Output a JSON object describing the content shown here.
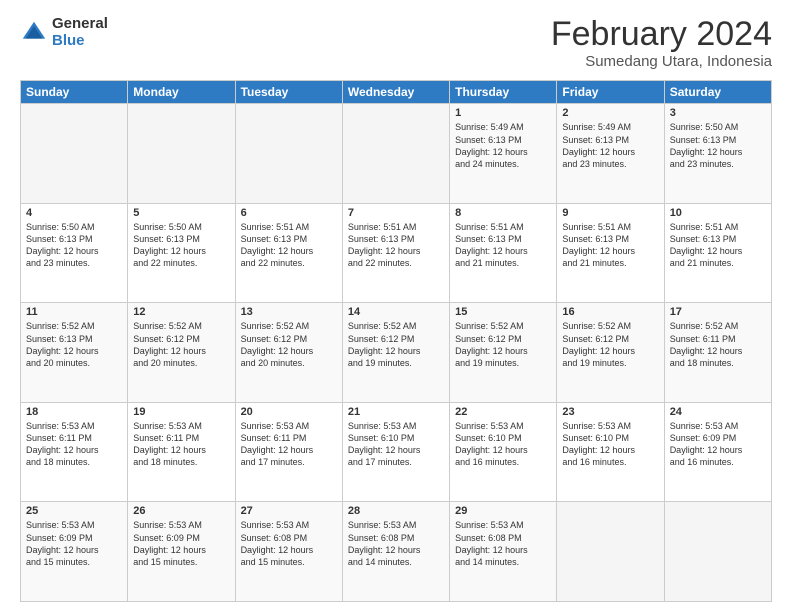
{
  "logo": {
    "general": "General",
    "blue": "Blue"
  },
  "header": {
    "month": "February 2024",
    "location": "Sumedang Utara, Indonesia"
  },
  "weekdays": [
    "Sunday",
    "Monday",
    "Tuesday",
    "Wednesday",
    "Thursday",
    "Friday",
    "Saturday"
  ],
  "weeks": [
    [
      {
        "day": "",
        "info": ""
      },
      {
        "day": "",
        "info": ""
      },
      {
        "day": "",
        "info": ""
      },
      {
        "day": "",
        "info": ""
      },
      {
        "day": "1",
        "info": "Sunrise: 5:49 AM\nSunset: 6:13 PM\nDaylight: 12 hours\nand 24 minutes."
      },
      {
        "day": "2",
        "info": "Sunrise: 5:49 AM\nSunset: 6:13 PM\nDaylight: 12 hours\nand 23 minutes."
      },
      {
        "day": "3",
        "info": "Sunrise: 5:50 AM\nSunset: 6:13 PM\nDaylight: 12 hours\nand 23 minutes."
      }
    ],
    [
      {
        "day": "4",
        "info": "Sunrise: 5:50 AM\nSunset: 6:13 PM\nDaylight: 12 hours\nand 23 minutes."
      },
      {
        "day": "5",
        "info": "Sunrise: 5:50 AM\nSunset: 6:13 PM\nDaylight: 12 hours\nand 22 minutes."
      },
      {
        "day": "6",
        "info": "Sunrise: 5:51 AM\nSunset: 6:13 PM\nDaylight: 12 hours\nand 22 minutes."
      },
      {
        "day": "7",
        "info": "Sunrise: 5:51 AM\nSunset: 6:13 PM\nDaylight: 12 hours\nand 22 minutes."
      },
      {
        "day": "8",
        "info": "Sunrise: 5:51 AM\nSunset: 6:13 PM\nDaylight: 12 hours\nand 21 minutes."
      },
      {
        "day": "9",
        "info": "Sunrise: 5:51 AM\nSunset: 6:13 PM\nDaylight: 12 hours\nand 21 minutes."
      },
      {
        "day": "10",
        "info": "Sunrise: 5:51 AM\nSunset: 6:13 PM\nDaylight: 12 hours\nand 21 minutes."
      }
    ],
    [
      {
        "day": "11",
        "info": "Sunrise: 5:52 AM\nSunset: 6:13 PM\nDaylight: 12 hours\nand 20 minutes."
      },
      {
        "day": "12",
        "info": "Sunrise: 5:52 AM\nSunset: 6:12 PM\nDaylight: 12 hours\nand 20 minutes."
      },
      {
        "day": "13",
        "info": "Sunrise: 5:52 AM\nSunset: 6:12 PM\nDaylight: 12 hours\nand 20 minutes."
      },
      {
        "day": "14",
        "info": "Sunrise: 5:52 AM\nSunset: 6:12 PM\nDaylight: 12 hours\nand 19 minutes."
      },
      {
        "day": "15",
        "info": "Sunrise: 5:52 AM\nSunset: 6:12 PM\nDaylight: 12 hours\nand 19 minutes."
      },
      {
        "day": "16",
        "info": "Sunrise: 5:52 AM\nSunset: 6:12 PM\nDaylight: 12 hours\nand 19 minutes."
      },
      {
        "day": "17",
        "info": "Sunrise: 5:52 AM\nSunset: 6:11 PM\nDaylight: 12 hours\nand 18 minutes."
      }
    ],
    [
      {
        "day": "18",
        "info": "Sunrise: 5:53 AM\nSunset: 6:11 PM\nDaylight: 12 hours\nand 18 minutes."
      },
      {
        "day": "19",
        "info": "Sunrise: 5:53 AM\nSunset: 6:11 PM\nDaylight: 12 hours\nand 18 minutes."
      },
      {
        "day": "20",
        "info": "Sunrise: 5:53 AM\nSunset: 6:11 PM\nDaylight: 12 hours\nand 17 minutes."
      },
      {
        "day": "21",
        "info": "Sunrise: 5:53 AM\nSunset: 6:10 PM\nDaylight: 12 hours\nand 17 minutes."
      },
      {
        "day": "22",
        "info": "Sunrise: 5:53 AM\nSunset: 6:10 PM\nDaylight: 12 hours\nand 16 minutes."
      },
      {
        "day": "23",
        "info": "Sunrise: 5:53 AM\nSunset: 6:10 PM\nDaylight: 12 hours\nand 16 minutes."
      },
      {
        "day": "24",
        "info": "Sunrise: 5:53 AM\nSunset: 6:09 PM\nDaylight: 12 hours\nand 16 minutes."
      }
    ],
    [
      {
        "day": "25",
        "info": "Sunrise: 5:53 AM\nSunset: 6:09 PM\nDaylight: 12 hours\nand 15 minutes."
      },
      {
        "day": "26",
        "info": "Sunrise: 5:53 AM\nSunset: 6:09 PM\nDaylight: 12 hours\nand 15 minutes."
      },
      {
        "day": "27",
        "info": "Sunrise: 5:53 AM\nSunset: 6:08 PM\nDaylight: 12 hours\nand 15 minutes."
      },
      {
        "day": "28",
        "info": "Sunrise: 5:53 AM\nSunset: 6:08 PM\nDaylight: 12 hours\nand 14 minutes."
      },
      {
        "day": "29",
        "info": "Sunrise: 5:53 AM\nSunset: 6:08 PM\nDaylight: 12 hours\nand 14 minutes."
      },
      {
        "day": "",
        "info": ""
      },
      {
        "day": "",
        "info": ""
      }
    ]
  ]
}
